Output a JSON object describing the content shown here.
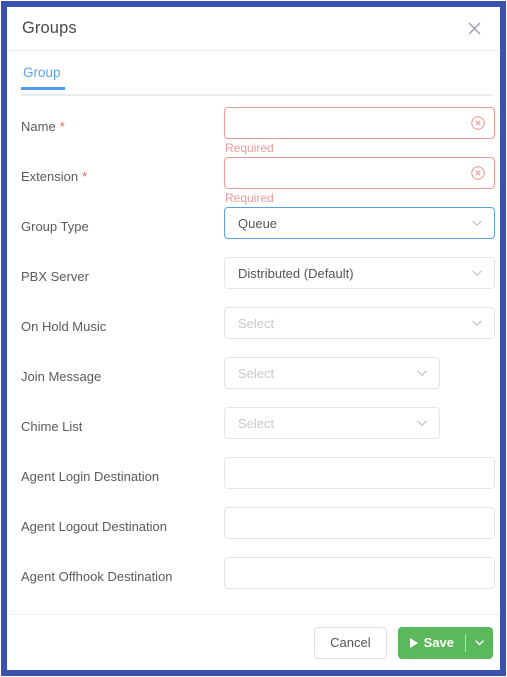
{
  "window": {
    "title": "Groups",
    "close_icon": "close-icon",
    "accent_border_color": "#3b51b0"
  },
  "tabs": [
    {
      "label": "Group",
      "active": true,
      "color": "#4f9bf0"
    }
  ],
  "form": {
    "fields": [
      {
        "label": "Name",
        "required": true,
        "type": "text",
        "value": "",
        "placeholder": "",
        "error": "Required",
        "clear_icon": "clear-circle-icon",
        "name": "name"
      },
      {
        "label": "Extension",
        "required": true,
        "type": "text",
        "value": "",
        "placeholder": "",
        "error": "Required",
        "clear_icon": "clear-circle-icon",
        "name": "extension"
      },
      {
        "label": "Group Type",
        "required": false,
        "type": "select",
        "value": "Queue",
        "is_placeholder": false,
        "focused": true,
        "narrow": false,
        "name": "group-type"
      },
      {
        "label": "PBX Server",
        "required": false,
        "type": "select",
        "value": "Distributed (Default)",
        "is_placeholder": false,
        "focused": false,
        "narrow": false,
        "name": "pbx-server"
      },
      {
        "label": "On Hold Music",
        "required": false,
        "type": "select",
        "value": "Select",
        "is_placeholder": true,
        "focused": false,
        "narrow": false,
        "name": "on-hold-music"
      },
      {
        "label": "Join Message",
        "required": false,
        "type": "select",
        "value": "Select",
        "is_placeholder": true,
        "focused": false,
        "narrow": true,
        "name": "join-message"
      },
      {
        "label": "Chime List",
        "required": false,
        "type": "select",
        "value": "Select",
        "is_placeholder": true,
        "focused": false,
        "narrow": true,
        "name": "chime-list"
      },
      {
        "label": "Agent Login Destination",
        "required": false,
        "type": "text",
        "value": "",
        "placeholder": "",
        "error": "",
        "name": "agent-login-destination"
      },
      {
        "label": "Agent Logout Destination",
        "required": false,
        "type": "text",
        "value": "",
        "placeholder": "",
        "error": "",
        "name": "agent-logout-destination"
      },
      {
        "label": "Agent Offhook Destination",
        "required": false,
        "type": "text",
        "value": "",
        "placeholder": "",
        "error": "",
        "name": "agent-offhook-destination"
      }
    ],
    "required_marker": "*"
  },
  "footer": {
    "cancel_label": "Cancel",
    "save_label": "Save",
    "save_icon": "play-triangle-icon",
    "save_caret_icon": "chevron-down-icon",
    "save_color": "#5cb85c"
  }
}
